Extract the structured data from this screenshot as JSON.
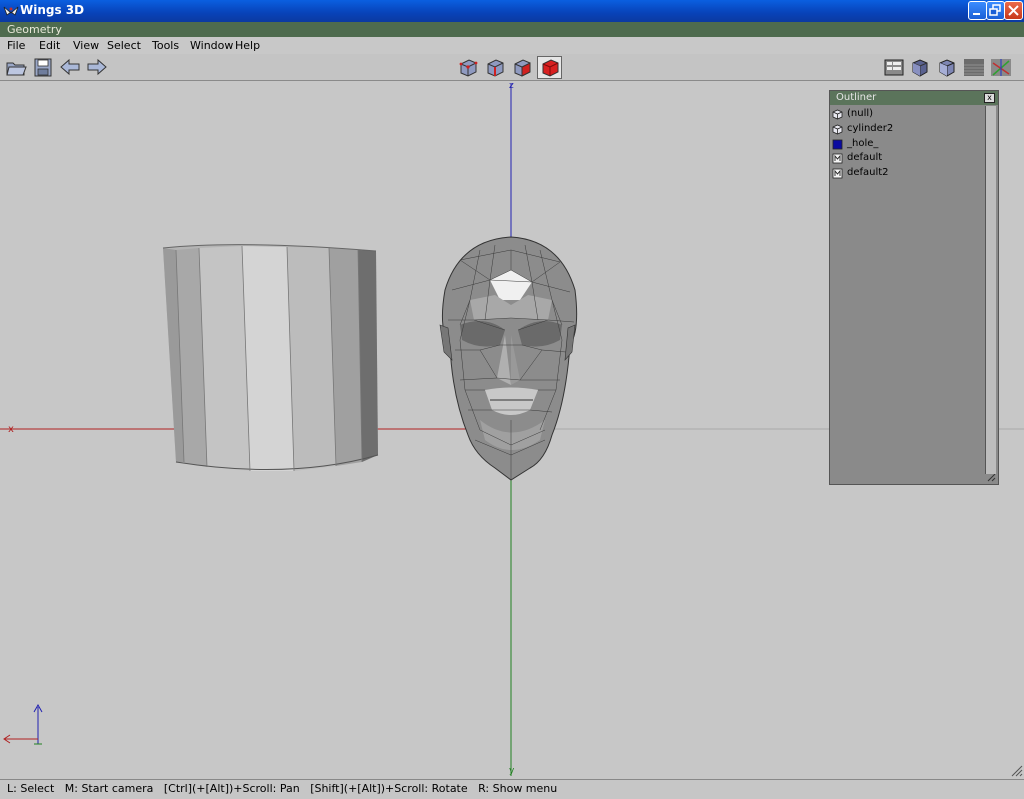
{
  "window": {
    "title": "Wings 3D"
  },
  "geometry_bar": {
    "title": "Geometry"
  },
  "menu": [
    "File",
    "Edit",
    "View",
    "Select",
    "Tools",
    "Window",
    "Help"
  ],
  "toolbar": {
    "left_icons": [
      "open-folder-icon",
      "save-icon",
      "undo-arrow-icon",
      "redo-arrow-icon"
    ],
    "selection_modes": [
      "vertex-mode-icon",
      "edge-mode-icon",
      "face-mode-icon",
      "body-mode-icon"
    ],
    "active_selection_mode": "body-mode-icon",
    "right_icons": [
      "workmode-icon",
      "smooth-shade-icon",
      "flat-shade-icon",
      "groundplane-icon",
      "axes-icon"
    ]
  },
  "viewport": {
    "axis_labels": {
      "x": "x",
      "y": "y",
      "z": "z"
    },
    "axis_colors": {
      "x": "#b02020",
      "y": "#208020",
      "z": "#2020b0"
    },
    "objects": [
      "cylinder",
      "head"
    ]
  },
  "outliner": {
    "title": "Outliner",
    "close": "x",
    "items": [
      {
        "icon": "object-cube-icon",
        "label": "(null)"
      },
      {
        "icon": "object-cube-icon",
        "label": "cylinder2"
      },
      {
        "icon": "material-swatch-icon",
        "label": "_hole_"
      },
      {
        "icon": "material-m-icon",
        "label": "default"
      },
      {
        "icon": "material-m-icon",
        "label": "default2"
      }
    ]
  },
  "statusbar": {
    "text": "L: Select   M: Start camera   [Ctrl](+[Alt])+Scroll: Pan   [Shift](+[Alt])+Scroll: Rotate   R: Show menu"
  }
}
